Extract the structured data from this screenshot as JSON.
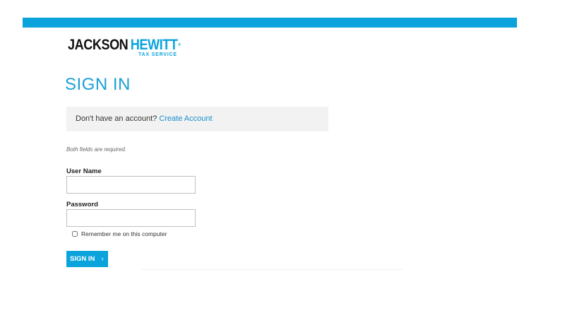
{
  "colors": {
    "brand_blue": "#0aa3dc",
    "title_blue": "#1aa0d6",
    "link_blue": "#1a8fcb",
    "panel_gray": "#f2f2f2"
  },
  "logo": {
    "brand_part1": "JACKSON",
    "brand_part2": "HEWITT",
    "trademark": "®",
    "tagline": "TAX SERVICE"
  },
  "page": {
    "title": "SIGN IN"
  },
  "account_prompt": {
    "text": "Don't have an account?",
    "link_label": "Create Account"
  },
  "form": {
    "required_note": "Both fields are required.",
    "username": {
      "label": "User Name",
      "value": "",
      "placeholder": ""
    },
    "password": {
      "label": "Password",
      "value": "",
      "placeholder": ""
    },
    "remember": {
      "label": "Remember me on this computer",
      "checked": false
    },
    "submit": {
      "label": "SIGN IN",
      "icon": "chevron-right-icon",
      "glyph": "›"
    }
  }
}
